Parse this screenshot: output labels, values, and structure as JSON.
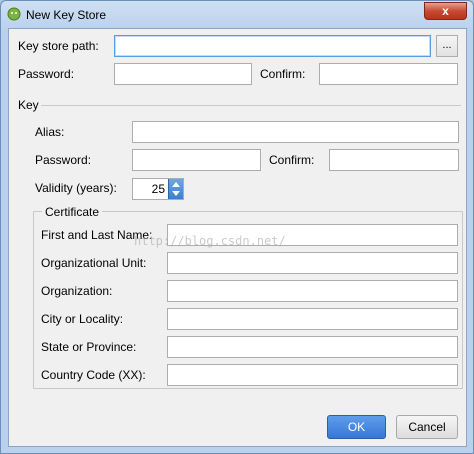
{
  "window": {
    "title": "New Key Store",
    "close_label": "x"
  },
  "keystore": {
    "path_label": "Key store path:",
    "path_value": "",
    "browse_label": "...",
    "password_label": "Password:",
    "confirm_label": "Confirm:"
  },
  "key": {
    "group_label": "Key",
    "alias_label": "Alias:",
    "password_label": "Password:",
    "confirm_label": "Confirm:",
    "validity_label": "Validity (years):",
    "validity_value": "25"
  },
  "certificate": {
    "group_label": "Certificate",
    "fields": [
      {
        "label": "First and Last Name:"
      },
      {
        "label": "Organizational Unit:"
      },
      {
        "label": "Organization:"
      },
      {
        "label": "City or Locality:"
      },
      {
        "label": "State or Province:"
      },
      {
        "label": "Country Code (XX):"
      }
    ]
  },
  "buttons": {
    "ok_label": "OK",
    "cancel_label": "Cancel"
  },
  "watermark": "http://blog.csdn.net/",
  "colors": {
    "accent": "#3678d4",
    "close": "#c74a33",
    "dialog_bg": "#f0f0f0"
  }
}
